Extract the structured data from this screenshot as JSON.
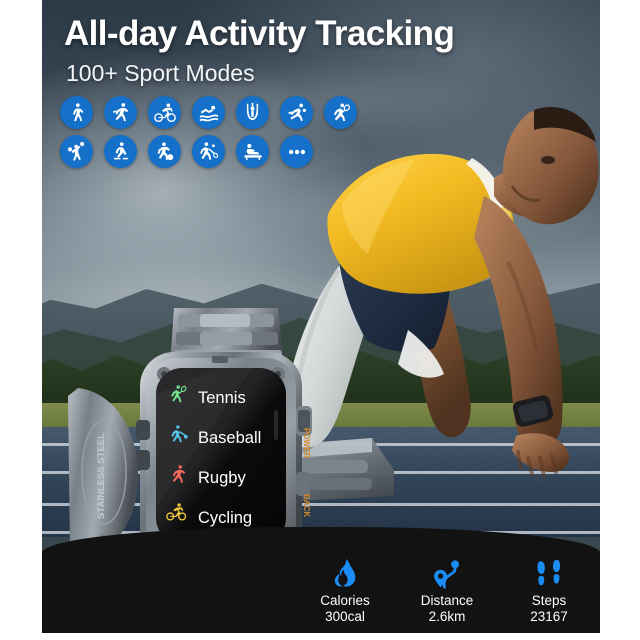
{
  "banner": {
    "headline": "All-day Activity Tracking",
    "subhead": "100+ Sport Modes",
    "accent_blue": "#1470c8",
    "panel_dark": "#121212"
  },
  "sport_modes": {
    "row1": [
      {
        "name": "walking",
        "icon": "walking-icon"
      },
      {
        "name": "running",
        "icon": "running-icon"
      },
      {
        "name": "cycling",
        "icon": "cycling-icon"
      },
      {
        "name": "swimming",
        "icon": "swimming-icon"
      },
      {
        "name": "gymnastics",
        "icon": "gymnastics-rings-icon"
      },
      {
        "name": "basketball",
        "icon": "basketball-icon"
      },
      {
        "name": "tennis",
        "icon": "tennis-icon"
      }
    ],
    "row2": [
      {
        "name": "boxing",
        "icon": "boxing-icon"
      },
      {
        "name": "skating",
        "icon": "skating-icon"
      },
      {
        "name": "soccer",
        "icon": "soccer-icon"
      },
      {
        "name": "badminton",
        "icon": "badminton-icon"
      },
      {
        "name": "sit-ups",
        "icon": "situps-icon"
      },
      {
        "name": "more",
        "icon": "ellipsis-icon"
      }
    ]
  },
  "watch": {
    "band_engraving": "STAINLESS STEEL",
    "side_button_top": "POWER",
    "side_button_bottom": "BACK",
    "screen": {
      "menu": [
        {
          "label": "Tennis",
          "color": "#6ede86"
        },
        {
          "label": "Baseball",
          "color": "#4fc3e8"
        },
        {
          "label": "Rugby",
          "color": "#f4675c"
        },
        {
          "label": "Cycling",
          "color": "#f2c93d"
        }
      ]
    }
  },
  "stats": [
    {
      "icon": "flame-icon",
      "label": "Calories",
      "value": "300cal"
    },
    {
      "icon": "route-pin-icon",
      "label": "Distance",
      "value": "2.6km"
    },
    {
      "icon": "footsteps-icon",
      "label": "Steps",
      "value": "23167"
    }
  ]
}
